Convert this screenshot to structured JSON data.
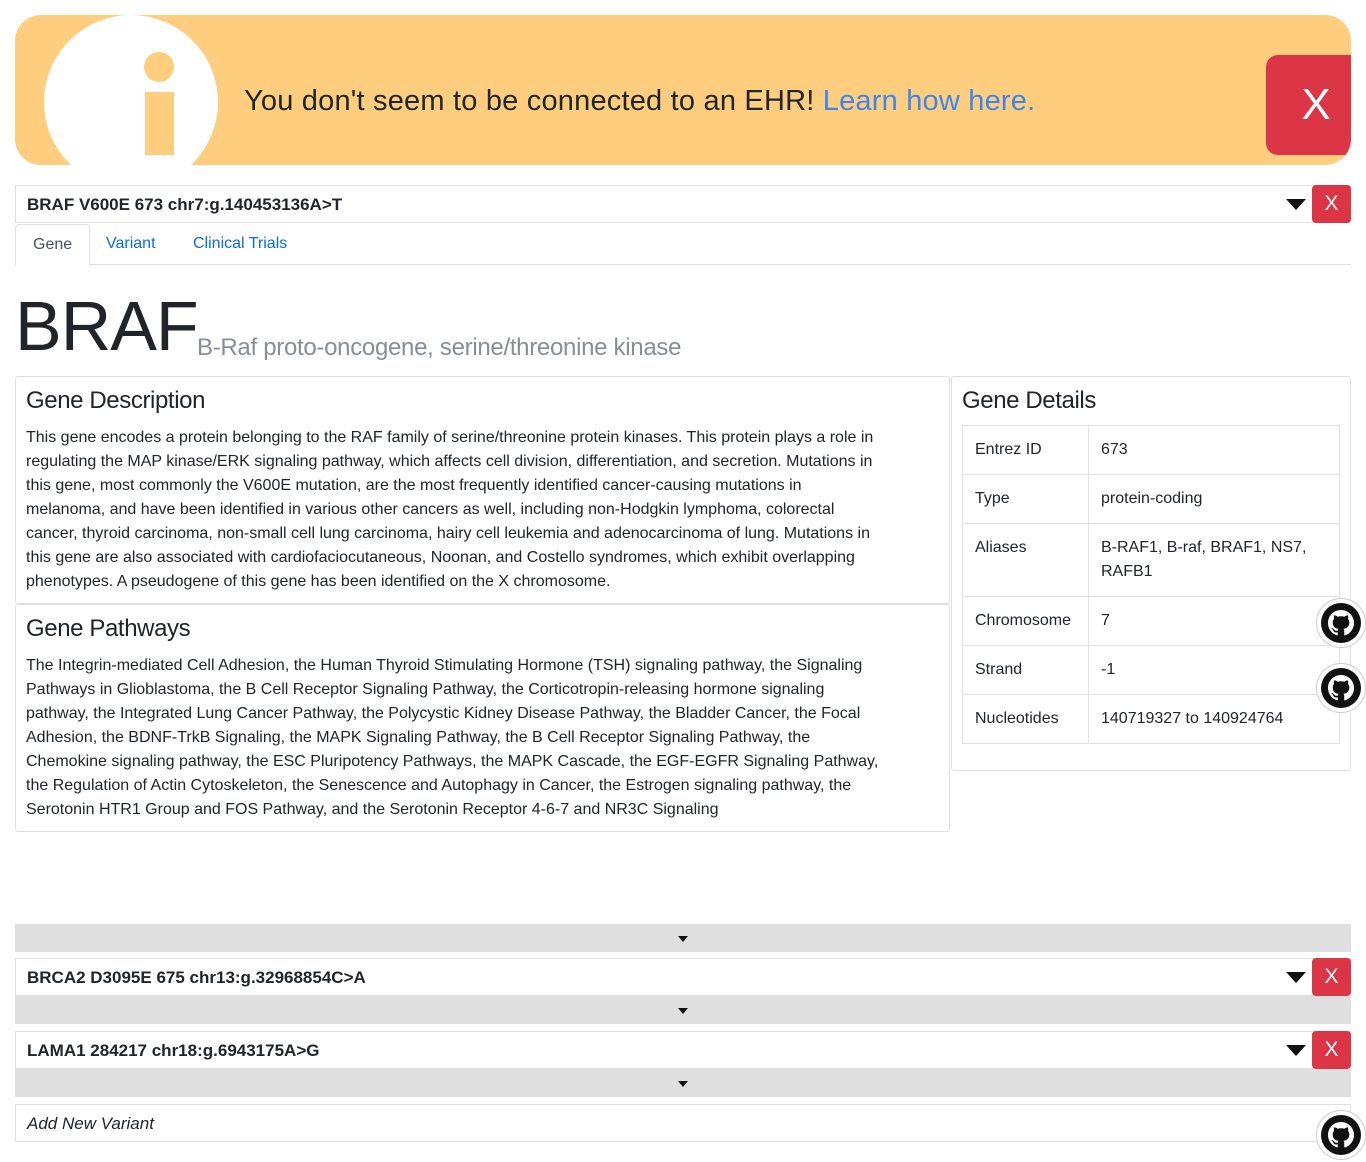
{
  "alert": {
    "message": "You don't seem to be connected to an EHR!",
    "link_text": "Learn how here.",
    "close_label": "X",
    "background_color": "#fecd7e",
    "icon": "info-icon"
  },
  "variants": [
    {
      "title": "BRAF V600E 673 chr7:g.140453136A>T",
      "close_label": "X",
      "expanded": true
    },
    {
      "title": "BRCA2 D3095E 675 chr13:g.32968854C>A",
      "close_label": "X",
      "expanded": false
    },
    {
      "title": "LAMA1 284217 chr18:g.6943175A>G",
      "close_label": "X",
      "expanded": false
    }
  ],
  "tabs": [
    {
      "label": "Gene",
      "active": true
    },
    {
      "label": "Variant",
      "active": false
    },
    {
      "label": "Clinical Trials",
      "active": false
    }
  ],
  "gene": {
    "symbol": "BRAF",
    "full_name": "B-Raf proto-oncogene, serine/threonine kinase",
    "description_title": "Gene Description",
    "description_lines": [
      "This gene encodes a protein belonging to the RAF family of serine/threonine protein kinases. This protein plays a role in",
      "regulating the MAP kinase/ERK signaling pathway, which affects cell division, differentiation, and secretion. Mutations in",
      "this gene, most commonly the V600E mutation, are the most frequently identified cancer-causing mutations in",
      "melanoma, and have been identified in various other cancers as well, including non-Hodgkin lymphoma, colorectal",
      "cancer, thyroid carcinoma, non-small cell lung carcinoma, hairy cell leukemia and adenocarcinoma of lung. Mutations in",
      "this gene are also associated with cardiofaciocutaneous, Noonan, and Costello syndromes, which exhibit overlapping",
      "phenotypes. A pseudogene of this gene has been identified on the X chromosome."
    ],
    "pathways_title": "Gene Pathways",
    "pathways_lines": [
      "The Integrin-mediated Cell Adhesion, the Human Thyroid Stimulating Hormone (TSH) signaling pathway, the Signaling",
      "Pathways in Glioblastoma, the B Cell Receptor Signaling Pathway, the Corticotropin-releasing hormone signaling",
      "pathway, the Integrated Lung Cancer Pathway, the Polycystic Kidney Disease Pathway, the Bladder Cancer, the Focal",
      "Adhesion, the BDNF-TrkB Signaling, the MAPK Signaling Pathway, the B Cell Receptor Signaling Pathway, the",
      "Chemokine signaling pathway, the ESC Pluripotency Pathways, the MAPK Cascade, the EGF-EGFR Signaling Pathway,",
      "the Regulation of Actin Cytoskeleton, the Senescence and Autophagy in Cancer, the Estrogen signaling pathway, the",
      "Serotonin HTR1 Group and FOS Pathway, and the Serotonin Receptor 4-6-7 and NR3C Signaling"
    ],
    "details_title": "Gene Details",
    "details": [
      {
        "key": "Entrez ID",
        "value": "673"
      },
      {
        "key": "Type",
        "value": "protein-coding"
      },
      {
        "key": "Aliases",
        "value": "B-RAF1, B-raf, BRAF1, NS7, RAFB1"
      },
      {
        "key": "Chromosome",
        "value": "7"
      },
      {
        "key": "Strand",
        "value": "-1"
      },
      {
        "key": "Nucleotides",
        "value": "140719327 to 140924764"
      }
    ]
  },
  "add_variant": {
    "placeholder": "Add New Variant"
  },
  "colors": {
    "danger": "#dc3545",
    "link": "#0b6ce6",
    "muted": "#888e93",
    "collapse_bar": "#dfdfdf"
  },
  "icons": [
    "info-icon",
    "caret-down-icon",
    "github-icon"
  ]
}
